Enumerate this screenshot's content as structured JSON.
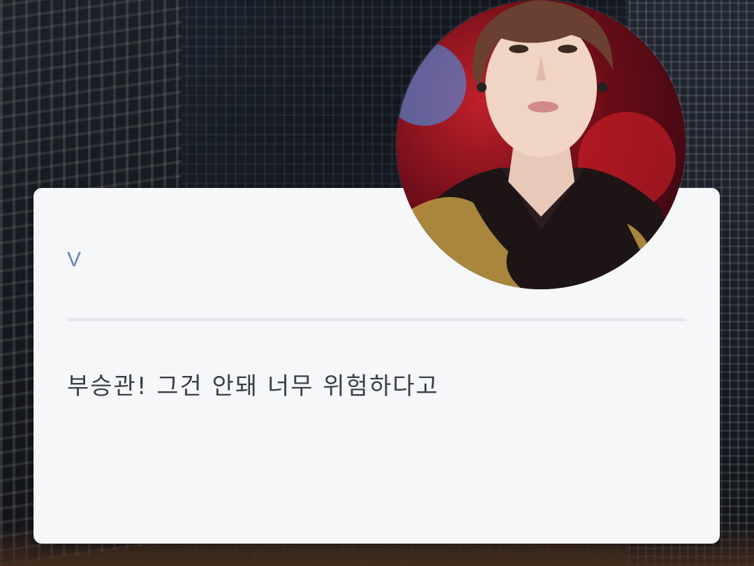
{
  "dialogue": {
    "speaker": "V",
    "message": "부승관! 그건 안돼 너무 위험하다고"
  },
  "colors": {
    "speaker": "#6b7fc4",
    "message": "#3a3f4a",
    "card_background": "#f6f7f9",
    "divider": "#e6e8ee"
  },
  "avatar": {
    "icon": "character-portrait"
  }
}
